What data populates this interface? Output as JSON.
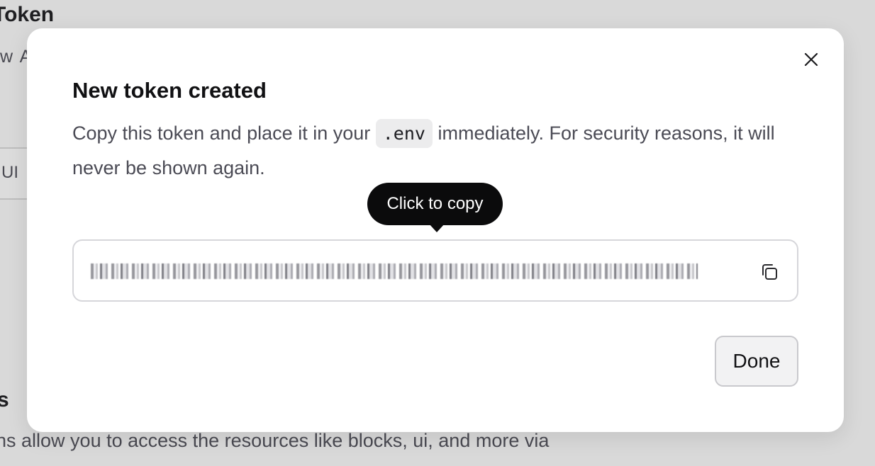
{
  "background": {
    "title": "Token",
    "subtitle": "w A",
    "tab_label": "UI",
    "section_heading": "s",
    "section_description": "ns allow you to access the resources like blocks, ui, and more via"
  },
  "modal": {
    "title": "New token created",
    "description_before": "Copy this token and place it in your ",
    "code": ".env",
    "description_after": " immediately. For security reasons, it will never be shown again.",
    "tooltip": "Click to copy",
    "done_label": "Done",
    "close_icon": "close-icon",
    "copy_icon": "copy-icon"
  }
}
